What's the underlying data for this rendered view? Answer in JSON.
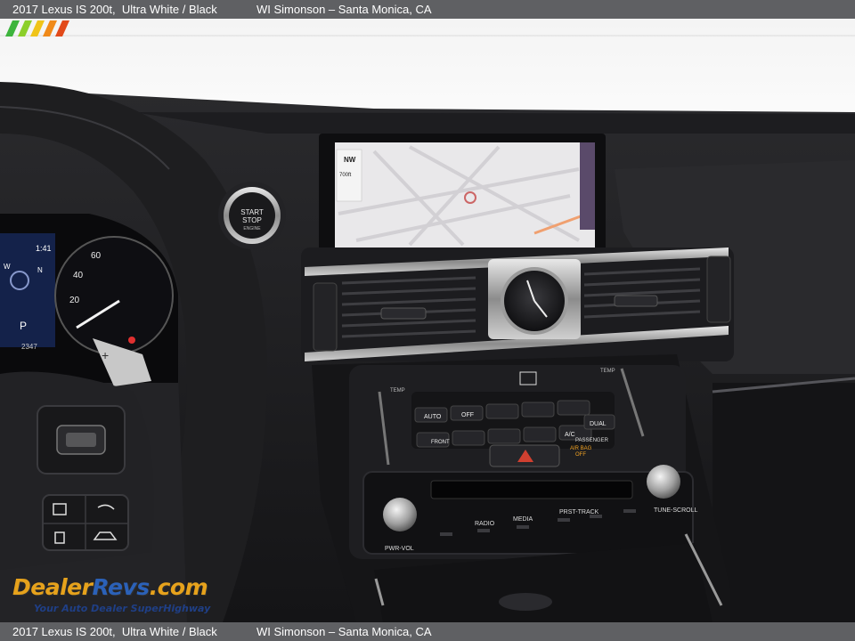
{
  "header": {
    "car": "2017 Lexus IS 200t,  Ultra White / Black",
    "dealer": "WI Simonson – Santa Monica, CA"
  },
  "footer": {
    "car": "2017 Lexus IS 200t,  Ultra White / Black",
    "dealer": "WI Simonson – Santa Monica, CA"
  },
  "dashboard": {
    "start_button": [
      "START",
      "STOP",
      "ENGINE"
    ],
    "nav_compass": "NW",
    "nav_distance": "700ft",
    "speedo_ticks": [
      "20",
      "40",
      "60"
    ],
    "cluster_time": "1:41",
    "cluster_compass": [
      "W",
      "N"
    ],
    "cluster_gear": "P",
    "cluster_odo": "2347",
    "climate_buttons": [
      "AUTO",
      "OFF",
      "FRONT",
      "A/C",
      "DUAL"
    ],
    "temp_labels": [
      "TEMP",
      "TEMP"
    ],
    "passenger_airbag": [
      "PASSENGER",
      "AIR BAG",
      "OFF"
    ],
    "media_buttons": [
      "RADIO",
      "MEDIA",
      "PRST-TRACK"
    ],
    "knob_labels": [
      "PWR-VOL",
      "TUNE-SCROLL"
    ]
  },
  "watermark": {
    "brand_dealer": "Dealer",
    "brand_revs": "Revs",
    "brand_com": ".com",
    "tagline": "Your Auto Dealer SuperHighway"
  },
  "colors": {
    "bar": "#5f6063",
    "brand_orange": "#e6a21c",
    "brand_blue": "#2b61b8"
  }
}
